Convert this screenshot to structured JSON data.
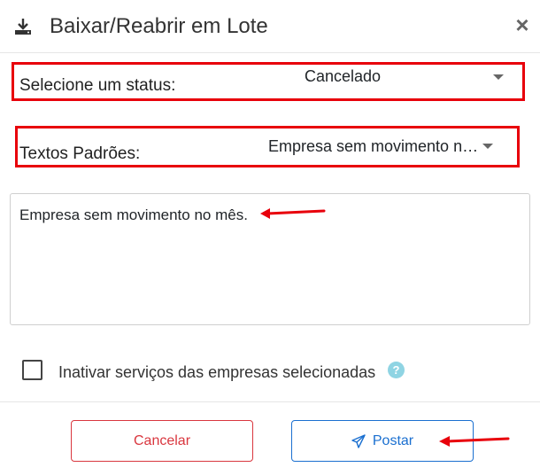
{
  "dialog": {
    "title": "Baixar/Reabrir em Lote",
    "close_label": "×"
  },
  "status": {
    "label": "Selecione um status:",
    "selected": "Cancelado"
  },
  "textos": {
    "label": "Textos Padrões:",
    "selected": "Empresa sem movimento no mês."
  },
  "message": {
    "value": "Empresa sem movimento no mês."
  },
  "inactivate": {
    "label": "Inativar serviços das empresas selecionadas",
    "checked": false,
    "help": "?"
  },
  "buttons": {
    "cancel_label": "Cancelar",
    "post_label": "Postar"
  },
  "colors": {
    "highlight_border": "#e8000b",
    "annotation_arrow": "#e8000b",
    "cancel": "#d9363e",
    "post": "#1a6fd0",
    "help_badge": "#8fd4e3"
  },
  "icons": {
    "header": "download-icon",
    "close": "close-icon",
    "dropdown": "caret-down-icon",
    "help": "help-icon",
    "post": "paper-plane-icon"
  }
}
